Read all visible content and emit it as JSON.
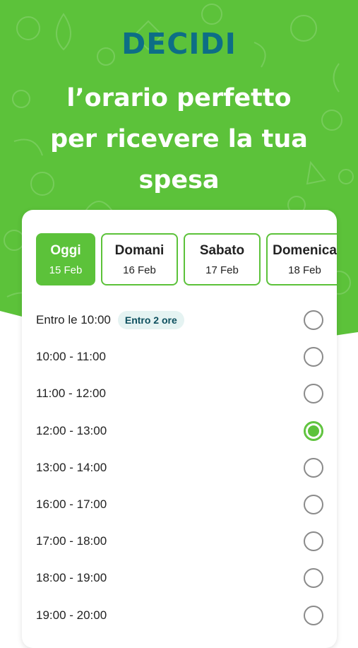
{
  "header": {
    "brand": "DECIDI",
    "tagline_line1": "l’orario perfetto",
    "tagline_line2": "per ricevere la tua",
    "tagline_line3": "spesa"
  },
  "colors": {
    "accent": "#5cc23a",
    "brand_text": "#0d6e86",
    "badge_bg": "#e5f3f2"
  },
  "days": [
    {
      "name": "Oggi",
      "date": "15 Feb",
      "selected": true
    },
    {
      "name": "Domani",
      "date": "16 Feb",
      "selected": false
    },
    {
      "name": "Sabato",
      "date": "17 Feb",
      "selected": false
    },
    {
      "name": "Domenica",
      "date": "18 Feb",
      "selected": false
    }
  ],
  "slots": [
    {
      "label": "Entro le 10:00",
      "badge": "Entro 2 ore",
      "checked": false
    },
    {
      "label": "10:00 - 11:00",
      "checked": false
    },
    {
      "label": "11:00 - 12:00",
      "checked": false
    },
    {
      "label": "12:00 - 13:00",
      "checked": true
    },
    {
      "label": "13:00 - 14:00",
      "checked": false
    },
    {
      "label": "16:00 - 17:00",
      "checked": false
    },
    {
      "label": "17:00 - 18:00",
      "checked": false
    },
    {
      "label": "18:00 - 19:00",
      "checked": false
    },
    {
      "label": "19:00 - 20:00",
      "checked": false
    }
  ]
}
